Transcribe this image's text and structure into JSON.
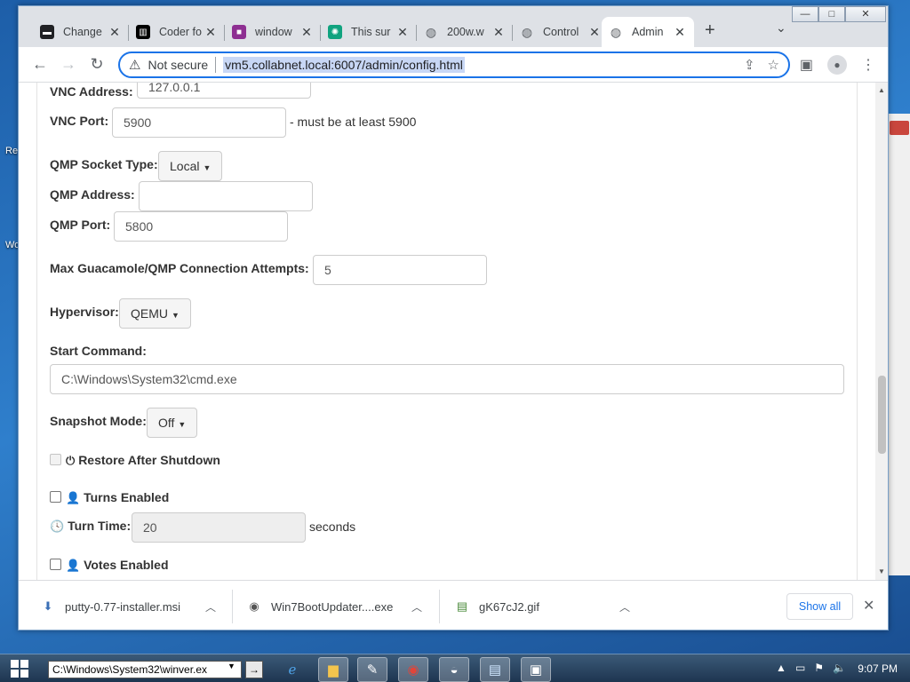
{
  "desktop": {
    "icon_labels": [
      "Re",
      "Wo"
    ]
  },
  "window": {
    "buttons": {
      "minimize": "—",
      "maximize": "□",
      "close": "✕"
    }
  },
  "tabs": [
    {
      "title": "Change",
      "icon": "page-icon",
      "color": "#202124"
    },
    {
      "title": "Coder fo",
      "icon": "coder-icon",
      "color": "#000000"
    },
    {
      "title": "window",
      "icon": "window-icon",
      "color": "#8e2f92"
    },
    {
      "title": "This sur",
      "icon": "chatgpt-icon",
      "color": "#10a37f"
    },
    {
      "title": "200w.w",
      "icon": "globe-icon",
      "color": "#5f6368"
    },
    {
      "title": "Control",
      "icon": "globe-icon",
      "color": "#5f6368"
    },
    {
      "title": "Admin",
      "icon": "globe-icon",
      "color": "#5f6368",
      "active": true
    }
  ],
  "toolbar": {
    "security_label": "Not secure",
    "url": "vm5.collabnet.local:6007/admin/config.html"
  },
  "form": {
    "vnc_address_label": "VNC Address:",
    "vnc_address_value": "127.0.0.1",
    "vnc_port_label": "VNC Port:",
    "vnc_port_value": "5900",
    "vnc_port_hint": "- must be at least 5900",
    "qmp_socket_label": "QMP Socket Type:",
    "qmp_socket_value": "Local",
    "qmp_address_label": "QMP Address:",
    "qmp_address_value": "",
    "qmp_port_label": "QMP Port:",
    "qmp_port_value": "5800",
    "max_attempts_label": "Max Guacamole/QMP Connection Attempts:",
    "max_attempts_value": "5",
    "hypervisor_label": "Hypervisor:",
    "hypervisor_value": "QEMU",
    "start_command_label": "Start Command:",
    "start_command_value": "C:\\Windows\\System32\\cmd.exe",
    "snapshot_label": "Snapshot Mode:",
    "snapshot_value": "Off",
    "restore_label": "Restore After Shutdown",
    "restore_checked": false,
    "turns_label": "Turns Enabled",
    "turns_checked": false,
    "turn_time_label": "Turn Time:",
    "turn_time_value": "20",
    "turn_time_unit": "seconds",
    "votes_label": "Votes Enabled",
    "votes_checked": false
  },
  "downloads": {
    "items": [
      {
        "name": "putty-0.77-installer.msi",
        "icon": "msi-installer-icon"
      },
      {
        "name": "Win7BootUpdater....exe",
        "icon": "exe-app-icon"
      },
      {
        "name": "gK67cJ2.gif",
        "icon": "image-file-icon"
      }
    ],
    "show_all": "Show all"
  },
  "taskbar": {
    "run_text": "C:\\Windows\\System32\\winver.ex",
    "go": "→",
    "apps": [
      "edge-icon",
      "explorer-icon",
      "paint-icon",
      "chrome-icon",
      "vm-icon",
      "notepad-icon",
      "remote-icon"
    ],
    "time": "9:07 PM"
  }
}
